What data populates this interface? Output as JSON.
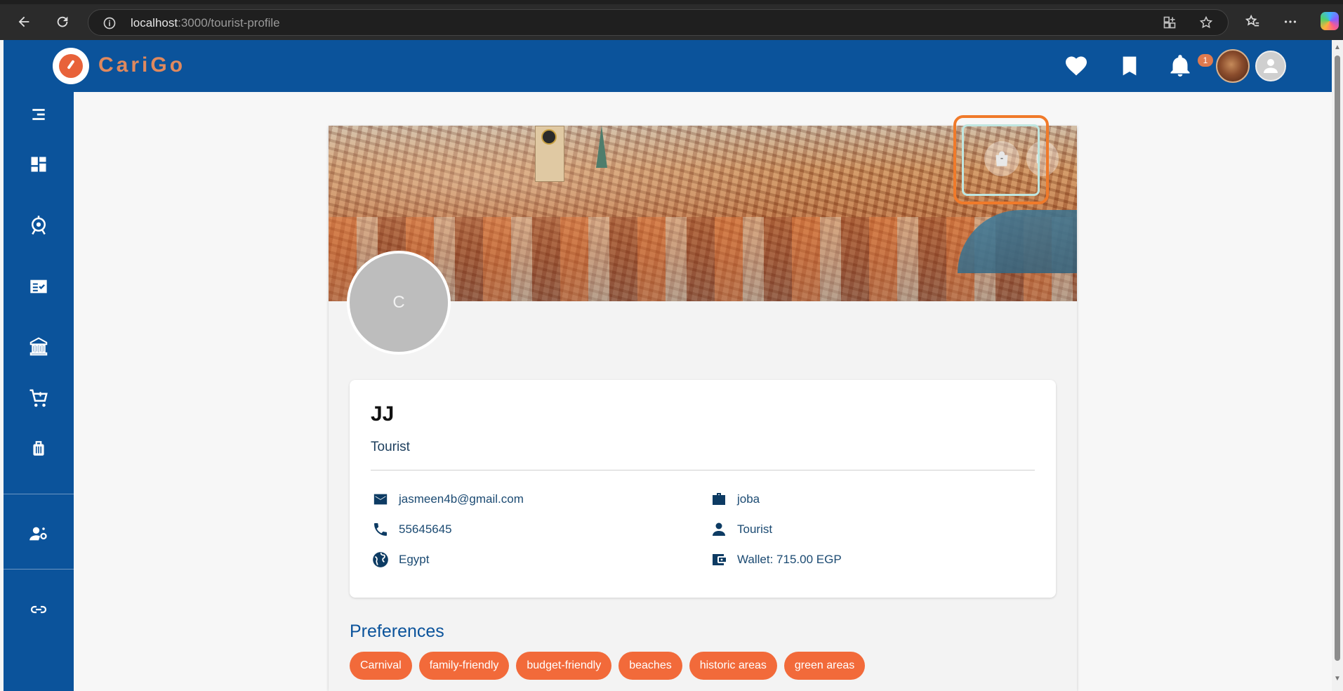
{
  "browser": {
    "url_host": "localhost",
    "url_path": ":3000/tourist-profile"
  },
  "header": {
    "brand": "CariGo",
    "notification_count": "1"
  },
  "sidebar": {
    "items": [
      "menu-icon",
      "dashboard-icon",
      "activities-icon",
      "itineraries-icon",
      "museums-icon",
      "cart-icon",
      "luggage-icon",
      "user-settings-icon",
      "link-icon"
    ]
  },
  "profile": {
    "avatar_initial": "C",
    "name": "JJ",
    "role": "Tourist",
    "email": "jasmeen4b@gmail.com",
    "phone": "55645645",
    "nationality": "Egypt",
    "job": "joba",
    "type": "Tourist",
    "wallet": "Wallet: 715.00 EGP"
  },
  "preferences": {
    "title": "Preferences",
    "tags": [
      "Carnival",
      "family-friendly",
      "budget-friendly",
      "beaches",
      "historic areas",
      "green areas"
    ]
  },
  "colors": {
    "primary": "#0b539b",
    "accent": "#f26a3a",
    "highlight": "#f07a2a"
  }
}
